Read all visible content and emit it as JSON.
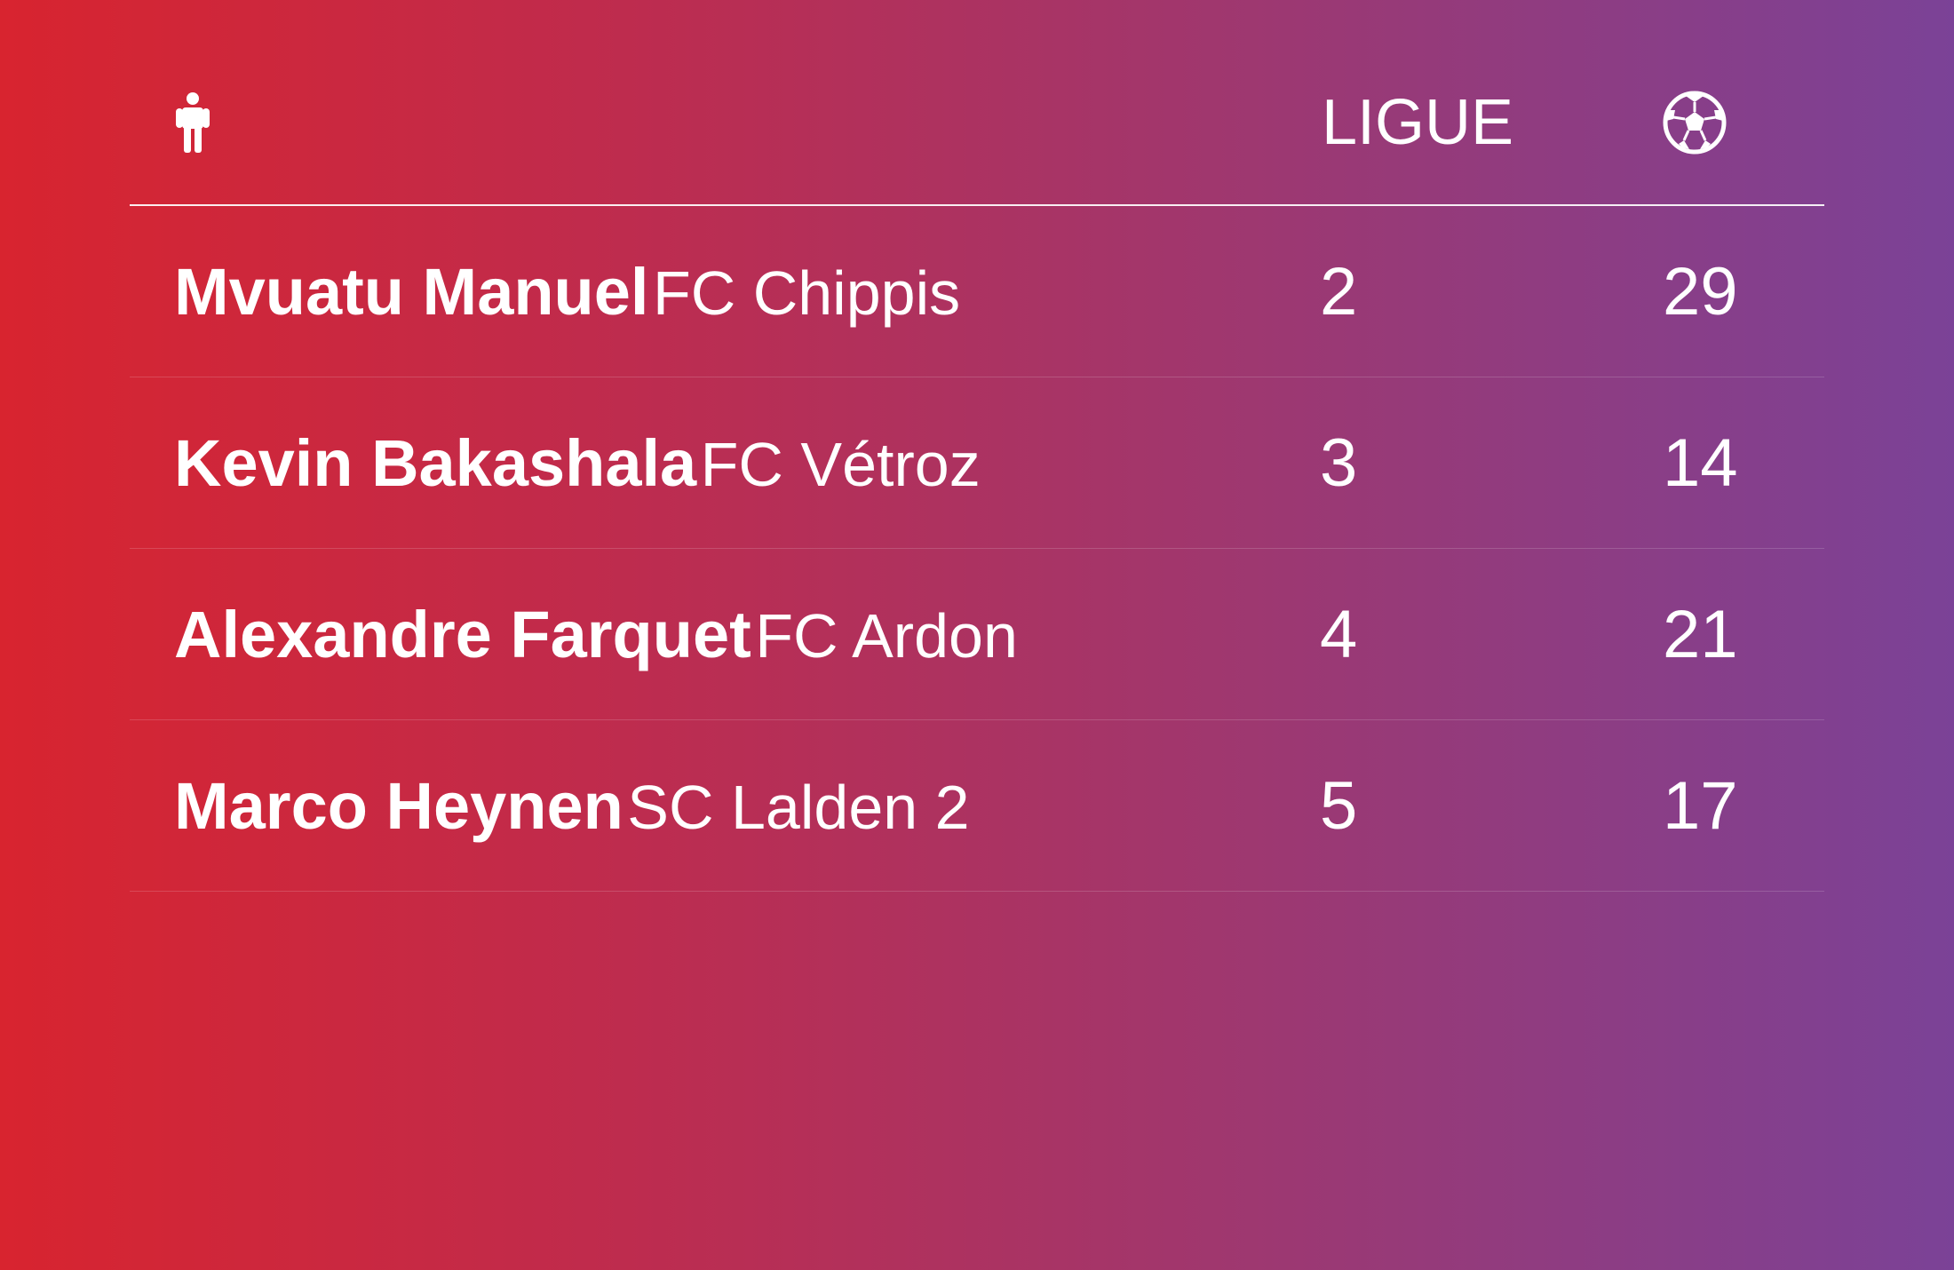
{
  "header": {
    "player_icon": "person-icon",
    "league_label": "LIGUE",
    "goals_icon": "soccer-ball-icon"
  },
  "colors": {
    "gradient_start": "#d8242f",
    "gradient_end": "#7b4297",
    "text": "#ffffff"
  },
  "rows": [
    {
      "name": "Mvuatu Manuel",
      "club": "FC Chippis",
      "league": "2",
      "goals": "29"
    },
    {
      "name": "Kevin Bakashala",
      "club": "FC Vétroz",
      "league": "3",
      "goals": "14"
    },
    {
      "name": "Alexandre Farquet",
      "club": "FC Ardon",
      "league": "4",
      "goals": "21"
    },
    {
      "name": "Marco Heynen",
      "club": "SC Lalden 2",
      "league": "5",
      "goals": "17"
    }
  ]
}
